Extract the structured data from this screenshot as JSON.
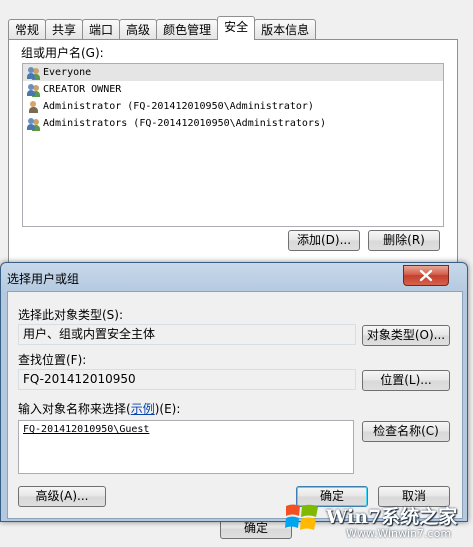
{
  "window": {
    "tabs": [
      "常规",
      "共享",
      "端口",
      "高级",
      "颜色管理",
      "安全",
      "版本信息"
    ],
    "active_tab": 5,
    "group_label": "组或用户名(G):",
    "users": [
      {
        "name": "Everyone",
        "icon": "group-icon"
      },
      {
        "name": "CREATOR OWNER",
        "icon": "group-icon"
      },
      {
        "name": "Administrator (FQ-201412010950\\Administrator)",
        "icon": "user-icon"
      },
      {
        "name": "Administrators (FQ-201412010950\\Administrators)",
        "icon": "group-icon"
      }
    ],
    "add_button": "添加(D)...",
    "remove_button": "删除(R)",
    "bottom_button": "确定"
  },
  "dialog": {
    "title": "选择用户或组",
    "object_type_label": "选择此对象类型(S):",
    "object_type_value": "用户、组或内置安全主体",
    "object_types_button": "对象类型(O)...",
    "location_label": "查找位置(F):",
    "location_value": "FQ-201412010950",
    "location_button": "位置(L)...",
    "enter_names_label_prefix": "输入对象名称来选择(",
    "examples_link": "示例",
    "enter_names_label_suffix": ")(E):",
    "entered_name": "FQ-201412010950\\Guest",
    "check_names_button": "检查名称(C)",
    "advanced_button": "高级(A)...",
    "ok_button": "确定",
    "cancel_button": "取消"
  },
  "watermark": {
    "brand": "Win7系统之家",
    "url": "Www.Winwin7.com"
  },
  "colors": {
    "accent": "#3c7fb1",
    "close": "#c2402e"
  }
}
